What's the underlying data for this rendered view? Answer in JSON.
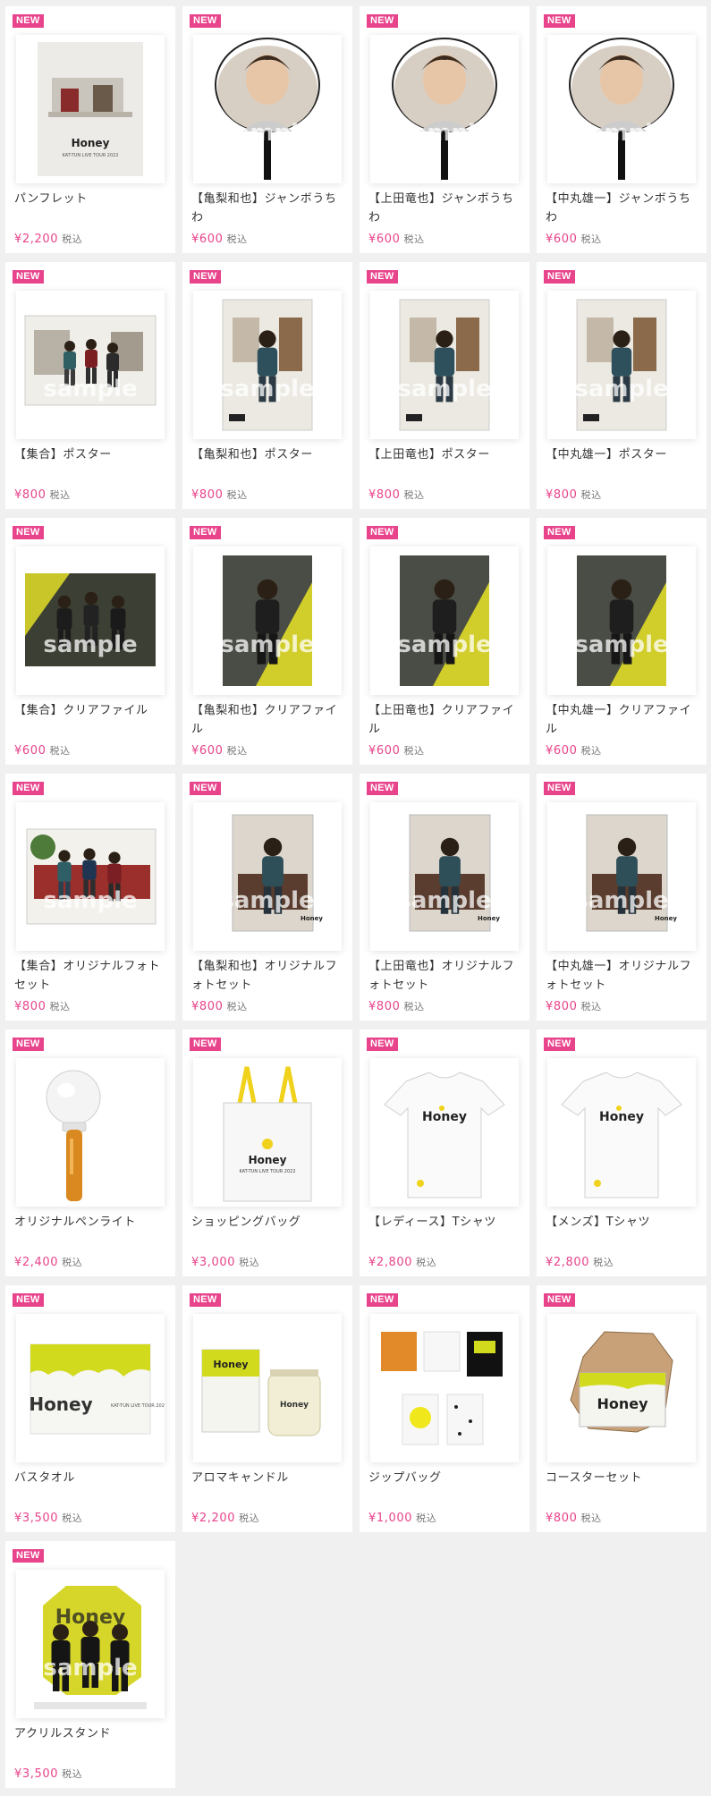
{
  "brand_color": "#e8448c",
  "badge_label": "NEW",
  "tax_label": "税込",
  "watermark": "sample",
  "products": [
    {
      "name": "パンフレット",
      "price": "¥2,200",
      "image": "pamphlet"
    },
    {
      "name": "【亀梨和也】ジャンボうちわ",
      "price": "¥600",
      "image": "fan"
    },
    {
      "name": "【上田竜也】ジャンボうちわ",
      "price": "¥600",
      "image": "fan"
    },
    {
      "name": "【中丸雄一】ジャンボうちわ",
      "price": "¥600",
      "image": "fan"
    },
    {
      "name": "【集合】ポスター",
      "price": "¥800",
      "image": "poster-wide"
    },
    {
      "name": "【亀梨和也】ポスター",
      "price": "¥800",
      "image": "poster-tall"
    },
    {
      "name": "【上田竜也】ポスター",
      "price": "¥800",
      "image": "poster-tall"
    },
    {
      "name": "【中丸雄一】ポスター",
      "price": "¥800",
      "image": "poster-tall"
    },
    {
      "name": "【集合】クリアファイル",
      "price": "¥600",
      "image": "file-wide"
    },
    {
      "name": "【亀梨和也】クリアファイル",
      "price": "¥600",
      "image": "file-tall"
    },
    {
      "name": "【上田竜也】クリアファイル",
      "price": "¥600",
      "image": "file-tall"
    },
    {
      "name": "【中丸雄一】クリアファイル",
      "price": "¥600",
      "image": "file-tall"
    },
    {
      "name": "【集合】オリジナルフォトセット",
      "price": "¥800",
      "image": "photo-wide"
    },
    {
      "name": "【亀梨和也】オリジナルフォトセット",
      "price": "¥800",
      "image": "photo-tall"
    },
    {
      "name": "【上田竜也】オリジナルフォトセット",
      "price": "¥800",
      "image": "photo-tall"
    },
    {
      "name": "【中丸雄一】オリジナルフォトセット",
      "price": "¥800",
      "image": "photo-tall"
    },
    {
      "name": "オリジナルペンライト",
      "price": "¥2,400",
      "image": "penlight"
    },
    {
      "name": "ショッピングバッグ",
      "price": "¥3,000",
      "image": "bag"
    },
    {
      "name": "【レディース】Tシャツ",
      "price": "¥2,800",
      "image": "tshirt"
    },
    {
      "name": "【メンズ】Tシャツ",
      "price": "¥2,800",
      "image": "tshirt"
    },
    {
      "name": "バスタオル",
      "price": "¥3,500",
      "image": "towel"
    },
    {
      "name": "アロマキャンドル",
      "price": "¥2,200",
      "image": "candle"
    },
    {
      "name": "ジップバッグ",
      "price": "¥1,000",
      "image": "zipbag"
    },
    {
      "name": "コースターセット",
      "price": "¥800",
      "image": "coaster"
    },
    {
      "name": "アクリルスタンド",
      "price": "¥3,500",
      "image": "acrylic"
    }
  ]
}
